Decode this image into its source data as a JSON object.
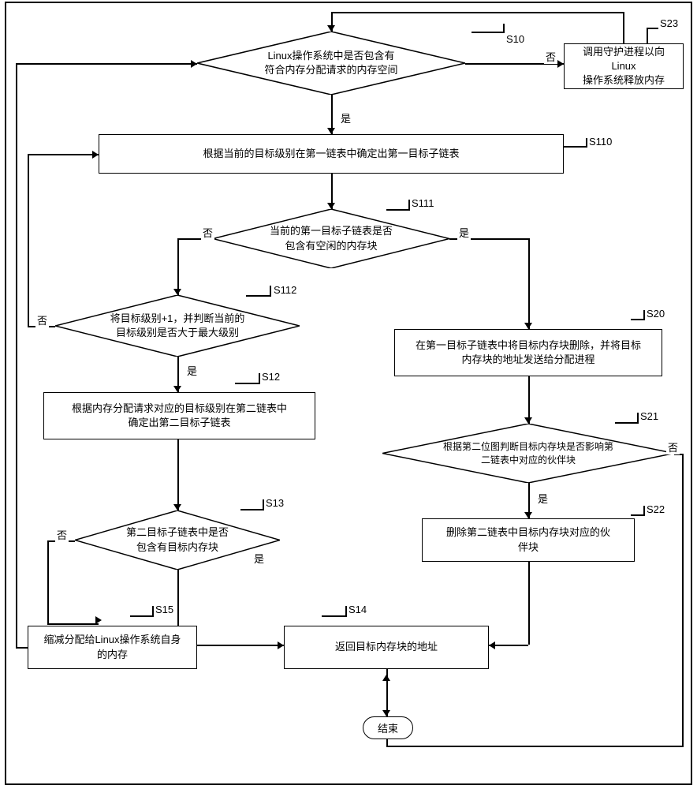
{
  "chart_data": {
    "type": "flowchart",
    "title": "",
    "nodes": [
      {
        "id": "S10",
        "shape": "diamond",
        "text": "Linux操作系统中是否包含有\n符合内存分配请求的内存空间",
        "step": "S10"
      },
      {
        "id": "S23",
        "shape": "rect",
        "text": "调用守护进程以向Linux\n操作系统释放内存",
        "step": "S23"
      },
      {
        "id": "S110",
        "shape": "rect",
        "text": "根据当前的目标级别在第一链表中确定出第一目标子链表",
        "step": "S110"
      },
      {
        "id": "S111",
        "shape": "diamond",
        "text": "当前的第一目标子链表是否\n包含有空闲的内存块",
        "step": "S111"
      },
      {
        "id": "S112",
        "shape": "diamond",
        "text": "将目标级别+1，并判断当前的\n目标级别是否大于最大级别",
        "step": "S112"
      },
      {
        "id": "S20",
        "shape": "rect",
        "text": "在第一目标子链表中将目标内存块删除，并将目标\n内存块的地址发送给分配进程",
        "step": "S20"
      },
      {
        "id": "S12",
        "shape": "rect",
        "text": "根据内存分配请求对应的目标级别在第二链表中\n确定出第二目标子链表",
        "step": "S12"
      },
      {
        "id": "S21",
        "shape": "diamond",
        "text": "根据第二位图判断目标内存块是否影响第\n二链表中对应的伙伴块",
        "step": "S21"
      },
      {
        "id": "S13",
        "shape": "diamond",
        "text": "第二目标子链表中是否\n包含有目标内存块",
        "step": "S13"
      },
      {
        "id": "S22",
        "shape": "rect",
        "text": "删除第二链表中目标内存块对应的伙\n伴块",
        "step": "S22"
      },
      {
        "id": "S15",
        "shape": "rect",
        "text": "缩减分配给Linux操作系统自身\n的内存",
        "step": "S15"
      },
      {
        "id": "S14",
        "shape": "rect",
        "text": "返回目标内存块的地址",
        "step": "S14"
      },
      {
        "id": "end",
        "shape": "terminator",
        "text": "结束"
      }
    ],
    "edges": [
      {
        "from": "S10",
        "to": "S23",
        "label": "否"
      },
      {
        "from": "S23",
        "to": "S10",
        "label": ""
      },
      {
        "from": "S10",
        "to": "S110",
        "label": "是"
      },
      {
        "from": "S110",
        "to": "S111",
        "label": ""
      },
      {
        "from": "S111",
        "to": "S112",
        "label": "否"
      },
      {
        "from": "S111",
        "to": "S20",
        "label": "是"
      },
      {
        "from": "S112",
        "to": "S110",
        "label": "否"
      },
      {
        "from": "S112",
        "to": "S12",
        "label": "是"
      },
      {
        "from": "S20",
        "to": "S21",
        "label": ""
      },
      {
        "from": "S12",
        "to": "S13",
        "label": ""
      },
      {
        "from": "S21",
        "to": "S22",
        "label": "是"
      },
      {
        "from": "S21",
        "to": "S14",
        "label": "否"
      },
      {
        "from": "S13",
        "to": "S15",
        "label": "否"
      },
      {
        "from": "S13",
        "to": "S14",
        "label": "是"
      },
      {
        "from": "S22",
        "to": "S14",
        "label": ""
      },
      {
        "from": "S15",
        "to": "S10",
        "label": ""
      },
      {
        "from": "S14",
        "to": "end",
        "label": ""
      }
    ]
  },
  "labels": {
    "yes": "是",
    "no": "否",
    "end": "结束"
  },
  "steps": {
    "s10": "S10",
    "s23": "S23",
    "s110": "S110",
    "s111": "S111",
    "s112": "S112",
    "s20": "S20",
    "s12": "S12",
    "s21": "S21",
    "s13": "S13",
    "s22": "S22",
    "s15": "S15",
    "s14": "S14"
  },
  "texts": {
    "s10": "Linux操作系统中是否包含有\n符合内存分配请求的内存空间",
    "s23": "调用守护进程以向Linux\n操作系统释放内存",
    "s110": "根据当前的目标级别在第一链表中确定出第一目标子链表",
    "s111": "当前的第一目标子链表是否\n包含有空闲的内存块",
    "s112": "将目标级别+1，并判断当前的\n目标级别是否大于最大级别",
    "s20": "在第一目标子链表中将目标内存块删除，并将目标\n内存块的地址发送给分配进程",
    "s12": "根据内存分配请求对应的目标级别在第二链表中\n确定出第二目标子链表",
    "s21": "根据第二位图判断目标内存块是否影响第\n二链表中对应的伙伴块",
    "s13": "第二目标子链表中是否\n包含有目标内存块",
    "s22": "删除第二链表中目标内存块对应的伙\n伴块",
    "s15": "缩减分配给Linux操作系统自身\n的内存",
    "s14": "返回目标内存块的地址"
  }
}
